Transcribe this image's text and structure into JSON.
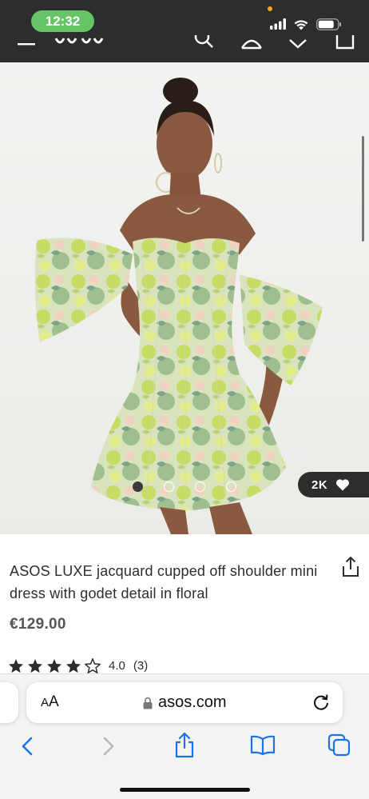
{
  "status_bar": {
    "time": "12:32",
    "icons": [
      "cellular-signal-icon",
      "wifi-icon",
      "battery-icon"
    ]
  },
  "header": {
    "icons": [
      "menu-icon",
      "asos-logo",
      "search-icon",
      "account-icon",
      "saved-items-icon",
      "bag-icon"
    ]
  },
  "gallery": {
    "image_description_icon": "product-photo",
    "image_count": 4,
    "active_index": 0,
    "saves_count": "2K",
    "saves_icon": "heart-icon"
  },
  "product": {
    "title": "ASOS LUXE jacquard cupped off shoulder mini dress with godet detail in floral",
    "price": "€129.00",
    "rating_stars": 4,
    "rating_max": 5,
    "rating_value": "4.0",
    "review_count": "(3)",
    "share_icon": "share-icon"
  },
  "browser": {
    "reader_label": "AA",
    "url": "asos.com",
    "lock_icon": "lock-icon",
    "reload_icon": "reload-icon",
    "toolbar": [
      "back-icon",
      "forward-icon",
      "share-icon",
      "bookmarks-icon",
      "tabs-icon"
    ]
  },
  "colors": {
    "header_bg": "#2d2d2d",
    "time_pill": "#65c466",
    "safari_accent": "#1a73e8",
    "price_text": "#555555"
  }
}
